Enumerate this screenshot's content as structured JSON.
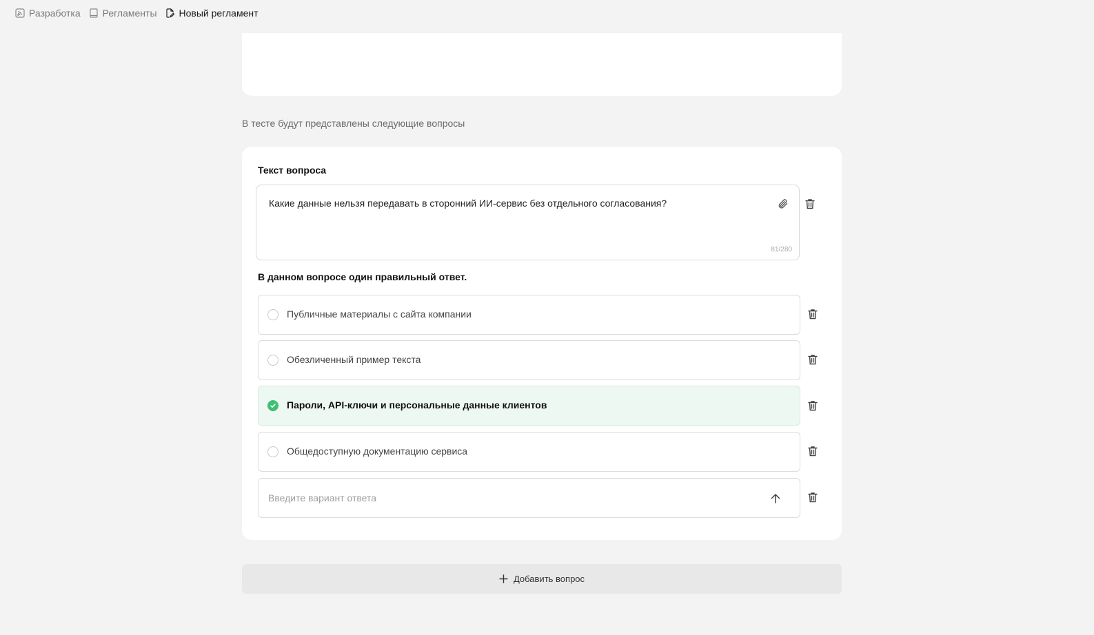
{
  "breadcrumb": {
    "items": [
      {
        "label": "Разработка",
        "icon": "feed-icon"
      },
      {
        "label": "Регламенты",
        "icon": "book-icon"
      },
      {
        "label": "Новый регламент",
        "icon": "edit-document-icon"
      }
    ]
  },
  "section_label": "В тесте будут представлены следующие вопросы",
  "question": {
    "title": "Текст вопроса",
    "text": "Какие данные нельзя передавать в сторонний ИИ-сервис без отдельного согласования?",
    "counter": "81/280",
    "answers_title": "В данном вопросе один правильный ответ.",
    "answers": [
      {
        "label": "Публичные материалы с сайта компании",
        "correct": false
      },
      {
        "label": "Обезличенный пример текста",
        "correct": false
      },
      {
        "label": "Пароли, API-ключи и персональные данные клиентов",
        "correct": true
      },
      {
        "label": "Общедоступную документацию сервиса",
        "correct": false
      }
    ],
    "new_answer_placeholder": "Введите вариант ответа"
  },
  "add_question_label": "Добавить вопрос",
  "colors": {
    "accent_green": "#3fbf74",
    "correct_bg": "#eef8f2",
    "page_bg": "#f3f3f3"
  }
}
